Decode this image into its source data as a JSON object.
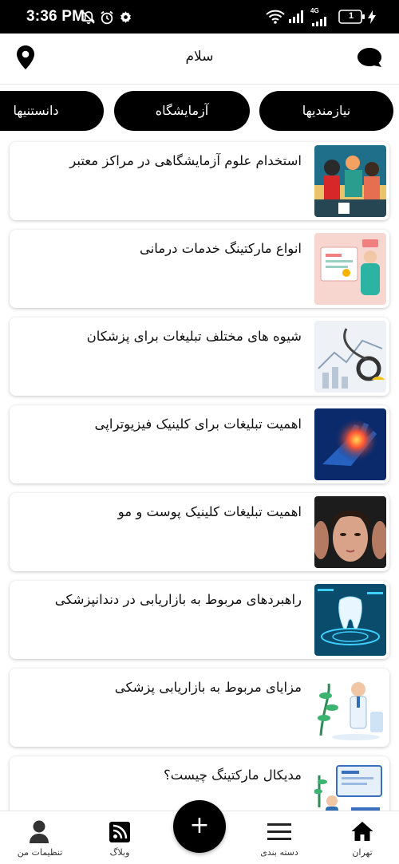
{
  "status_bar": {
    "time": "3:36 PM",
    "network": "4G",
    "battery": "1",
    "icons": [
      "mute-icon",
      "alarm-icon",
      "settings-gear-icon",
      "wifi-icon",
      "signal-icon",
      "battery-icon",
      "charging-icon"
    ]
  },
  "header": {
    "title": "سلام",
    "left_icon": "location-pin-icon",
    "right_icon": "chat-bubble-icon"
  },
  "tabs": [
    {
      "label": "نیازمندیها"
    },
    {
      "label": "آزمایشگاه"
    },
    {
      "label": "دانستنیها"
    }
  ],
  "articles": [
    {
      "title": "استخدام علوم آزمایشگاهی در مراکز معتبر",
      "thumb": "people-illustration"
    },
    {
      "title": "انواع مارکتینگ خدمات درمانی",
      "thumb": "doctor-screen-illustration"
    },
    {
      "title": "شیوه های مختلف تبلیغات برای پزشکان",
      "thumb": "stethoscope-charts-photo"
    },
    {
      "title": "اهمیت تبلیغات برای کلینیک فیزیوتراپی",
      "thumb": "hand-pain-xray-image"
    },
    {
      "title": "اهمیت تبلیغات کلینیک پوست و مو",
      "thumb": "woman-face-photo"
    },
    {
      "title": "راهبردهای مربوط به بازاریابی در دندانپزشکی",
      "thumb": "digital-tooth-image"
    },
    {
      "title": "مزایای مربوط به بازاریابی پزشکی",
      "thumb": "doctor-plants-illustration"
    },
    {
      "title": "مدیکال مارکتینگ چیست؟",
      "thumb": "medical-screen-illustration"
    }
  ],
  "bottom_nav": [
    {
      "label": "تهران",
      "icon": "home-icon"
    },
    {
      "label": "دسته بندی",
      "icon": "menu-list-icon"
    },
    {
      "label": "وبلاگ",
      "icon": "rss-feed-icon"
    },
    {
      "label": "تنظیمات من",
      "icon": "user-profile-icon"
    }
  ],
  "fab": {
    "label": "+"
  }
}
